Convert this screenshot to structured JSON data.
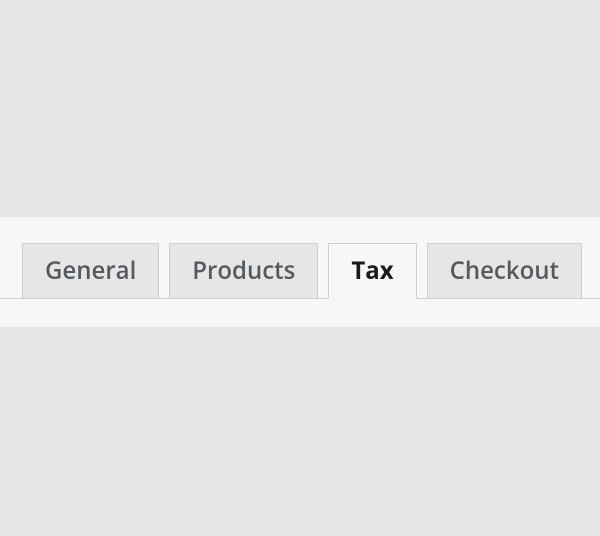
{
  "tabs": [
    {
      "label": "General",
      "active": false
    },
    {
      "label": "Products",
      "active": false
    },
    {
      "label": "Tax",
      "active": true
    },
    {
      "label": "Checkout",
      "active": false
    }
  ]
}
